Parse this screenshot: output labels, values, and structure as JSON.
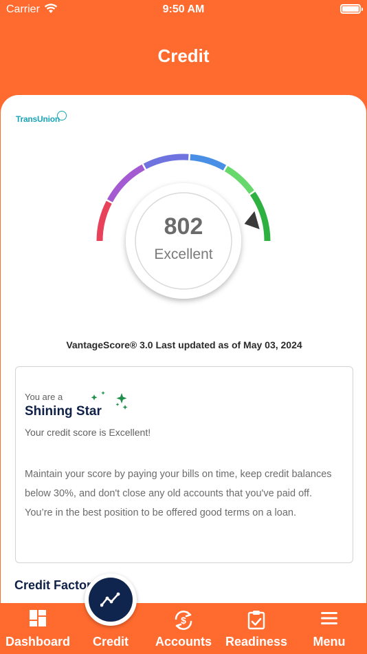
{
  "status_bar": {
    "carrier": "Carrier",
    "time": "9:50 AM"
  },
  "header": {
    "title": "Credit"
  },
  "bureau": {
    "logo_text": "TransUnion"
  },
  "score": {
    "value": "802",
    "rating": "Excellent",
    "min": 300,
    "max": 850,
    "gauge_colors": [
      "#e8415a",
      "#a45ad0",
      "#6f73e0",
      "#4a8fe6",
      "#67d96c",
      "#2fb142"
    ]
  },
  "vantage": {
    "text": "VantageScore® 3.0 Last updated as of May 03, 2024"
  },
  "info": {
    "prefix": "You are a",
    "heading": "Shining Star",
    "summary": "Your credit score is Excellent!",
    "body": "Maintain your score by paying your bills on time, keep credit balances below 30%, and don't close any old accounts that you've paid off. You’re in the best position to be offered good terms on a loan."
  },
  "section": {
    "credit_factors": "Credit Factors"
  },
  "tabs": [
    {
      "label": "Dashboard",
      "icon": "dashboard-icon"
    },
    {
      "label": "Credit",
      "icon": "chart-line-icon"
    },
    {
      "label": "Accounts",
      "icon": "dollar-sync-icon"
    },
    {
      "label": "Readiness",
      "icon": "clipboard-check-icon"
    },
    {
      "label": "Menu",
      "icon": "hamburger-menu-icon"
    }
  ],
  "colors": {
    "brand_orange": "#ff6a2f",
    "navy": "#10254e",
    "teal": "#17a5b8",
    "sparkle_green": "#1e8e4a"
  }
}
